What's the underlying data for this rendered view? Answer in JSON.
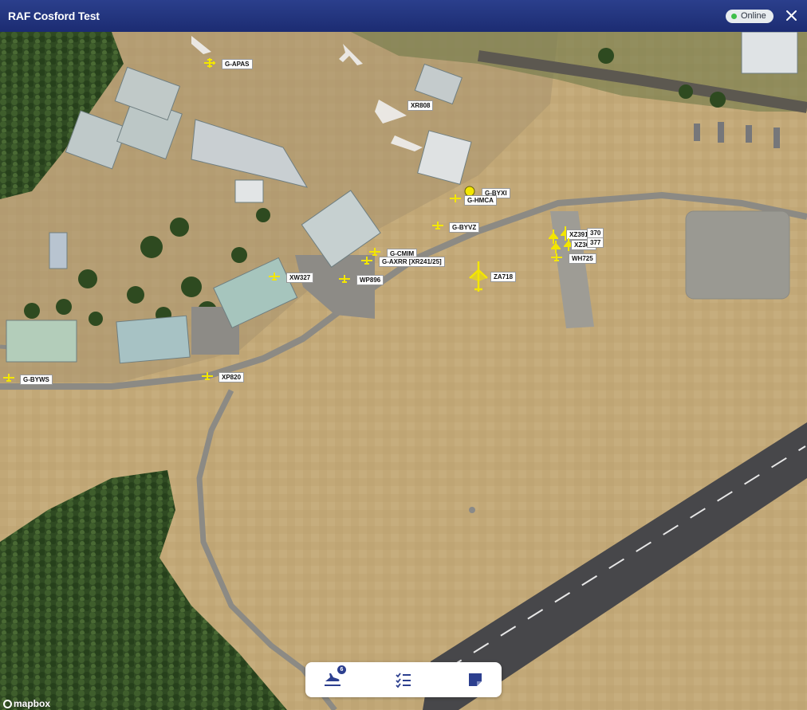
{
  "window": {
    "title": "RAF Cosford Test",
    "status": "Online",
    "status_color": "#3fbf4a",
    "accent": "#2b3f8c"
  },
  "map": {
    "attribution": "mapbox",
    "marker_color": "#f3e600",
    "aircraft": [
      {
        "label": "G-APAS"
      },
      {
        "label": "XR808"
      },
      {
        "label": "G-BYXI"
      },
      {
        "label": "G-HMCA"
      },
      {
        "label": "G-BYVZ"
      },
      {
        "label": "G-CMIM"
      },
      {
        "label": "G-AXRR [XR241/25]"
      },
      {
        "label": "XW327"
      },
      {
        "label": "WP896"
      },
      {
        "label": "ZA718"
      },
      {
        "label": "XZ391"
      },
      {
        "label": "370"
      },
      {
        "label": "XZ367"
      },
      {
        "label": "377"
      },
      {
        "label": "WH725"
      },
      {
        "label": "G-BYWS"
      },
      {
        "label": "XP820"
      }
    ]
  },
  "toolbar": {
    "items": [
      {
        "icon": "plane-landing-icon",
        "badge": "6"
      },
      {
        "icon": "checklist-icon"
      },
      {
        "icon": "note-icon"
      }
    ]
  }
}
